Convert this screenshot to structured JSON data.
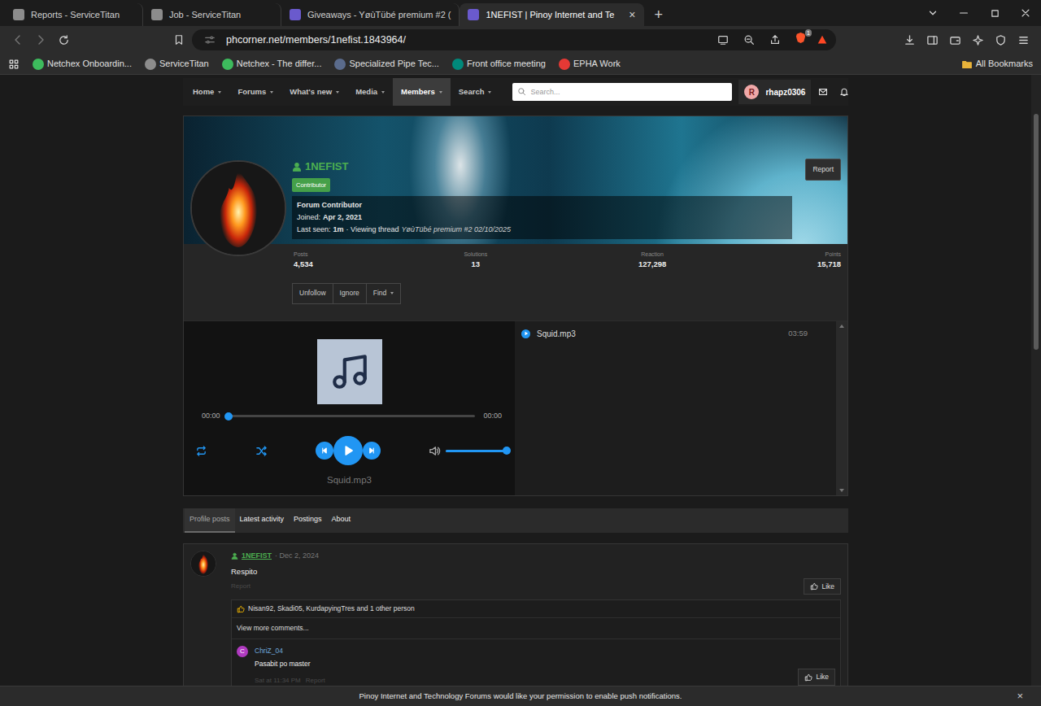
{
  "browser": {
    "tabs": [
      {
        "label": "Reports - ServiceTitan",
        "selected": false,
        "color": "#8c8c8c"
      },
      {
        "label": "Job - ServiceTitan",
        "selected": false,
        "color": "#8c8c8c"
      },
      {
        "label": "Giveaways - YøùTübé premium #2 (",
        "selected": false,
        "color": "#6a5acd"
      },
      {
        "label": "1NEFIST | Pinoy Internet and Te",
        "selected": true,
        "color": "#6a5acd"
      }
    ],
    "close": "×",
    "new_tab": "+",
    "address": "phcorner.net/members/1nefist.1843964/",
    "shield_count": "1",
    "bookmarks": [
      {
        "label": "Netchex Onboardin...",
        "color": "#3dbb5d"
      },
      {
        "label": "ServiceTitan",
        "color": "#8c8c8c"
      },
      {
        "label": "Netchex - The differ...",
        "color": "#3dbb5d"
      },
      {
        "label": "Specialized Pipe Tec...",
        "color": "#5a6b8c"
      },
      {
        "label": "Front office meeting",
        "color": "#00897b"
      },
      {
        "label": "EPHA Work",
        "color": "#e53935"
      }
    ],
    "all_bookmarks": "All Bookmarks"
  },
  "site_nav": {
    "items": [
      {
        "label": "Home",
        "selected": false
      },
      {
        "label": "Forums",
        "selected": false
      },
      {
        "label": "What's new",
        "selected": false
      },
      {
        "label": "Media",
        "selected": false
      },
      {
        "label": "Members",
        "selected": true
      },
      {
        "label": "Search",
        "selected": false
      }
    ],
    "search_placeholder": "Search...",
    "user": {
      "initial": "R",
      "name": "rhapz0306"
    }
  },
  "profile": {
    "name": "1NEFIST",
    "badge": "Contributor",
    "title": "Forum Contributor",
    "joined_label": "Joined:",
    "joined": "Apr 2, 2021",
    "last_seen_label": "Last seen:",
    "last_seen": "1m",
    "activity": "· Viewing thread",
    "thread": "YøùTübé premium #2 02/10/2025",
    "report": "Report",
    "stats": [
      {
        "label": "Posts",
        "value": "4,534"
      },
      {
        "label": "Solutions",
        "value": "13"
      },
      {
        "label": "Reaction",
        "value": "127,298"
      },
      {
        "label": "Points",
        "value": "15,718"
      }
    ],
    "actions": [
      "Unfollow",
      "Ignore",
      "Find"
    ]
  },
  "player": {
    "elapsed": "00:00",
    "duration": "00:00",
    "level": 0,
    "volume": 1,
    "now_playing": "Squid.mp3",
    "playlist": [
      {
        "title": "Squid.mp3",
        "length": "03:59",
        "selected": true
      }
    ]
  },
  "profile_tabs": [
    {
      "label": "Profile posts",
      "selected": true
    },
    {
      "label": "Latest activity",
      "selected": false
    },
    {
      "label": "Postings",
      "selected": false
    },
    {
      "label": "About",
      "selected": false
    }
  ],
  "posts": [
    {
      "author": "1NEFIST",
      "date": "· Dec 2, 2024",
      "body": "Respito",
      "action": "Report",
      "like": "Like",
      "reactions": "Nisan92, Skadi05, KurdapyingTres and 1 other person",
      "more_comments": "View more comments...",
      "comments": [
        {
          "initial": "C",
          "color": "#b03ac0",
          "author": "ChriZ_04",
          "body": "Pasabit po master",
          "date": "Sat at 11:34 PM",
          "report": "Report",
          "like": "Like"
        }
      ]
    }
  ],
  "notification": {
    "text": "Pinoy Internet and Technology Forums would like your permission to enable push notifications.",
    "close": "×"
  }
}
